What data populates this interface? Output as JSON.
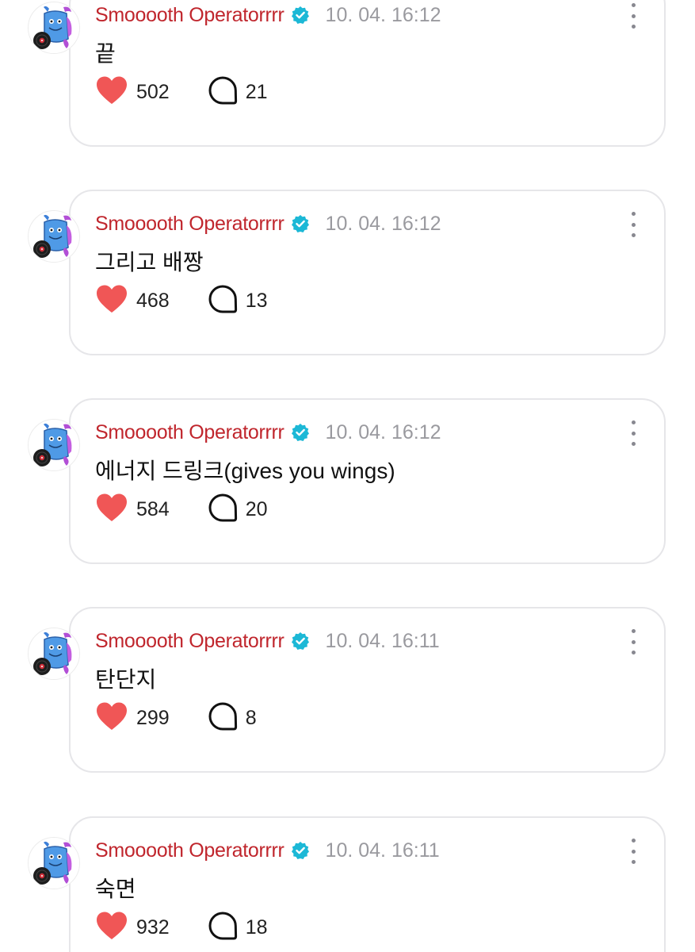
{
  "colors": {
    "username": "#c0262d",
    "verified_badge": "#1cb8d6",
    "timestamp": "#9a9a9f",
    "heart": "#f05656",
    "card_border": "#e6e6e9"
  },
  "icons": {
    "verified": "verified-badge-icon",
    "like": "heart-icon",
    "reply": "speech-bubble-icon",
    "more": "more-options-icon"
  },
  "posts": [
    {
      "username": "Smooooth Operatorrrr",
      "timestamp": "10. 04. 16:12",
      "content": "끝",
      "likes": "502",
      "replies": "21"
    },
    {
      "username": "Smooooth Operatorrrr",
      "timestamp": "10. 04. 16:12",
      "content": "그리고 배짱",
      "likes": "468",
      "replies": "13"
    },
    {
      "username": "Smooooth Operatorrrr",
      "timestamp": "10. 04. 16:12",
      "content": "에너지 드링크(gives you wings)",
      "likes": "584",
      "replies": "20"
    },
    {
      "username": "Smooooth Operatorrrr",
      "timestamp": "10. 04. 16:11",
      "content": "탄단지",
      "likes": "299",
      "replies": "8"
    },
    {
      "username": "Smooooth Operatorrrr",
      "timestamp": "10. 04. 16:11",
      "content": "숙면",
      "likes": "932",
      "replies": "18"
    }
  ]
}
